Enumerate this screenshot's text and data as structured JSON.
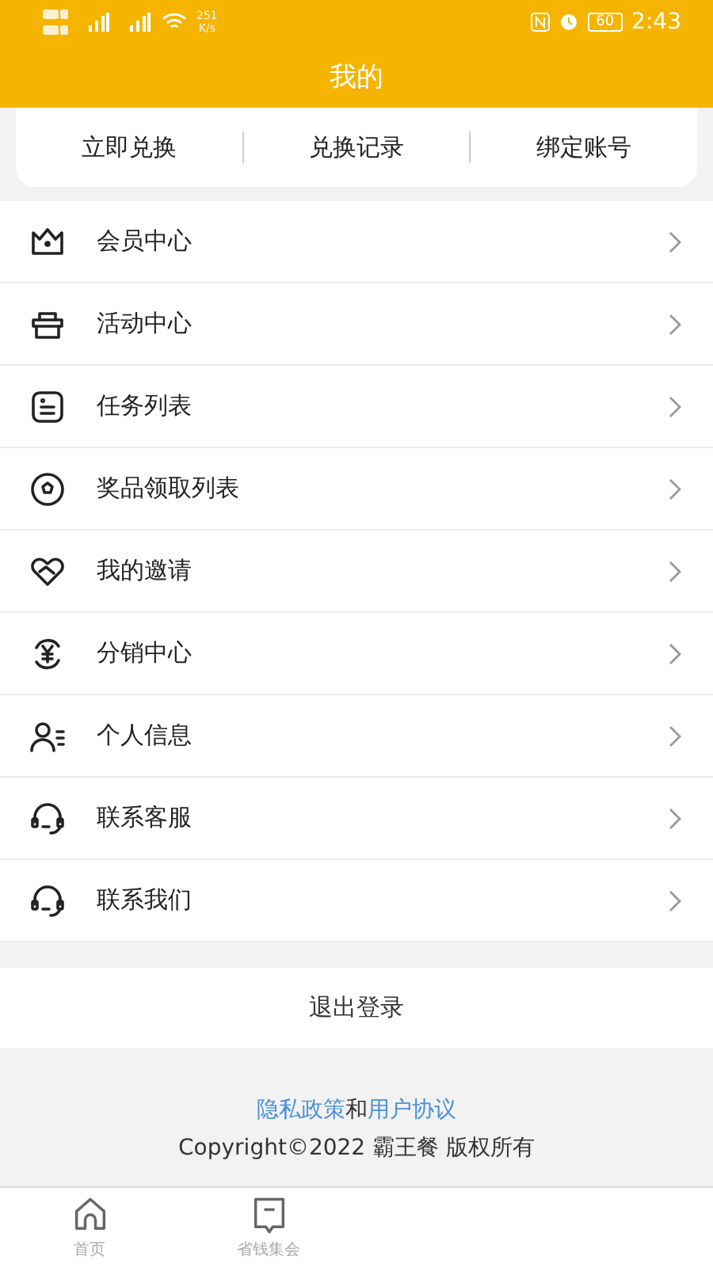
{
  "status_bar": {
    "speed_value": "251",
    "speed_unit": "K/s",
    "battery": "60",
    "time": "2:43"
  },
  "header": {
    "title": "我的"
  },
  "top_tabs": [
    {
      "label": "立即兑换"
    },
    {
      "label": "兑换记录"
    },
    {
      "label": "绑定账号"
    }
  ],
  "menu": [
    {
      "kind": "crown",
      "label": "会员中心"
    },
    {
      "kind": "gift",
      "label": "活动中心"
    },
    {
      "kind": "list",
      "label": "任务列表"
    },
    {
      "kind": "prize",
      "label": "奖品领取列表"
    },
    {
      "kind": "heart",
      "label": "我的邀请"
    },
    {
      "kind": "yuan",
      "label": "分销中心"
    },
    {
      "kind": "person",
      "label": "个人信息"
    },
    {
      "kind": "headset",
      "label": "联系客服"
    },
    {
      "kind": "headset",
      "label": "联系我们"
    }
  ],
  "logout": "退出登录",
  "footer": {
    "privacy_link": "隐私政策",
    "joiner": "和",
    "terms_link": "用户协议",
    "copyright": "Copyright©2022 霸王餐 版权所有"
  },
  "bottom_nav": [
    {
      "kind": "home",
      "label": "首页"
    },
    {
      "kind": "chat",
      "label": "省钱集会"
    }
  ]
}
